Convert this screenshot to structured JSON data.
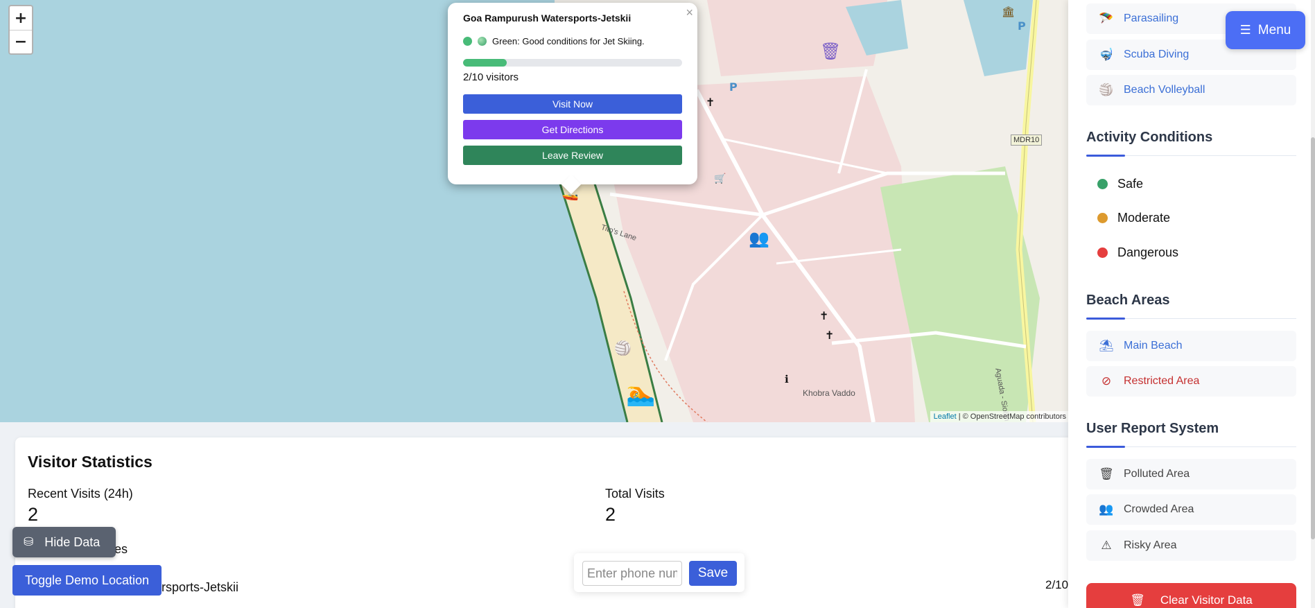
{
  "map": {
    "zoom_in": "+",
    "zoom_out": "−",
    "attribution_link": "Leaflet",
    "attribution_text": "| © OpenStreetMap contributors",
    "labels": {
      "titos_lane": "Tito's Lane",
      "khobra_vaddo": "Khobra Vaddo",
      "aguada": "Aguada - Siolim Road",
      "road_mdr10": "MDR10",
      "parking": "P"
    }
  },
  "popup": {
    "close": "×",
    "title": "Goa Rampurush Watersports-Jetskii",
    "condition": "Green: Good conditions for Jet Skiing.",
    "visitors_text": "2/10 visitors",
    "occupancy_fraction": 0.2,
    "visit_now": "Visit Now",
    "get_directions": "Get Directions",
    "leave_review": "Leave Review"
  },
  "menu": {
    "label": "Menu"
  },
  "sidebar": {
    "activities": [
      {
        "label": "Parasailing",
        "icon": "parasailing-icon"
      },
      {
        "label": "Scuba Diving",
        "icon": "scuba-diving-icon"
      },
      {
        "label": "Beach Volleyball",
        "icon": "beach-volleyball-icon"
      }
    ],
    "conditions_heading": "Activity Conditions",
    "conditions": [
      {
        "label": "Safe",
        "color": "#38a169"
      },
      {
        "label": "Moderate",
        "color": "#dd9a2e"
      },
      {
        "label": "Dangerous",
        "color": "#e53e3e"
      }
    ],
    "beach_heading": "Beach Areas",
    "beach_areas": [
      {
        "label": "Main Beach",
        "icon": "umbrella-icon"
      },
      {
        "label": "Restricted Area",
        "icon": "ban-icon"
      }
    ],
    "report_heading": "User Report System",
    "reports": [
      {
        "label": "Polluted Area",
        "icon": "trash-icon"
      },
      {
        "label": "Crowded Area",
        "icon": "users-icon"
      },
      {
        "label": "Risky Area",
        "icon": "warning-icon"
      }
    ],
    "clear_label": "Clear Visitor Data"
  },
  "stats": {
    "title": "Visitor Statistics",
    "recent_label": "Recent Visits (24h)",
    "recent_value": "2",
    "total_label": "Total Visits",
    "total_value": "2",
    "list_label_partial": "es",
    "row_name_partial": "rsports-Jetskii",
    "row_count_partial": "2/10"
  },
  "controls": {
    "hide_data": "Hide Data",
    "toggle_demo": "Toggle Demo Location",
    "phone_placeholder": "Enter phone number",
    "save": "Save"
  },
  "colors": {
    "visit_now": "#3b5fd9",
    "get_directions": "#7c3aed",
    "leave_review": "#2f855a",
    "accent": "#4c6ef5"
  }
}
